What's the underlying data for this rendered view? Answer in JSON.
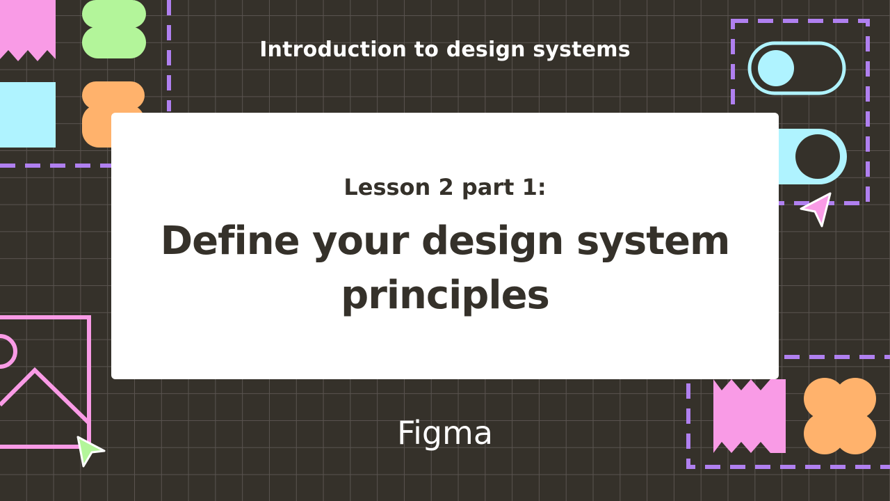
{
  "header": {
    "course_title": "Introduction to design systems"
  },
  "card": {
    "lesson_label": "Lesson 2 part 1:",
    "lesson_title": "Define your design system principles"
  },
  "footer": {
    "brand": "Figma"
  },
  "colors": {
    "background": "#35312a",
    "grid": "#5a5450",
    "pink": "#f99be6",
    "green": "#b3f59a",
    "cyan": "#aff3ff",
    "orange": "#ffb26c",
    "purple": "#b080f0",
    "card": "#ffffff",
    "text_dark": "#35312a"
  },
  "icons": [
    "cursor-arrow-icon",
    "toggle-switch-icon",
    "image-placeholder-icon"
  ]
}
